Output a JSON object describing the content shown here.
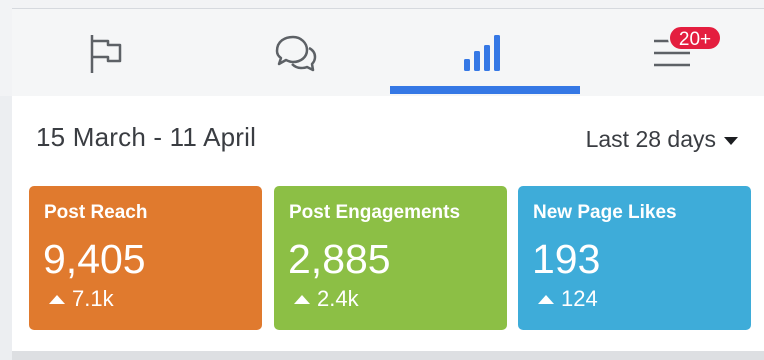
{
  "nav": {
    "tabs": [
      {
        "name": "pages",
        "icon": "flag-icon"
      },
      {
        "name": "messages",
        "icon": "chat-bubbles-icon"
      },
      {
        "name": "insights",
        "icon": "bar-chart-icon",
        "active": true
      },
      {
        "name": "menu",
        "icon": "hamburger-menu-icon"
      }
    ],
    "notification_badge": "20+",
    "active_color": "#3578e5",
    "badge_color": "#e41e3f"
  },
  "insights": {
    "date_range": "15 March - 11 April",
    "period_selector": "Last 28 days",
    "cards": [
      {
        "title": "Post Reach",
        "value": "9,405",
        "delta": "7.1k",
        "color": "#e07a2e"
      },
      {
        "title": "Post Engagements",
        "value": "2,885",
        "delta": "2.4k",
        "color": "#8cbf45"
      },
      {
        "title": "New Page Likes",
        "value": "193",
        "delta": "124",
        "color": "#3eacd9"
      }
    ]
  }
}
